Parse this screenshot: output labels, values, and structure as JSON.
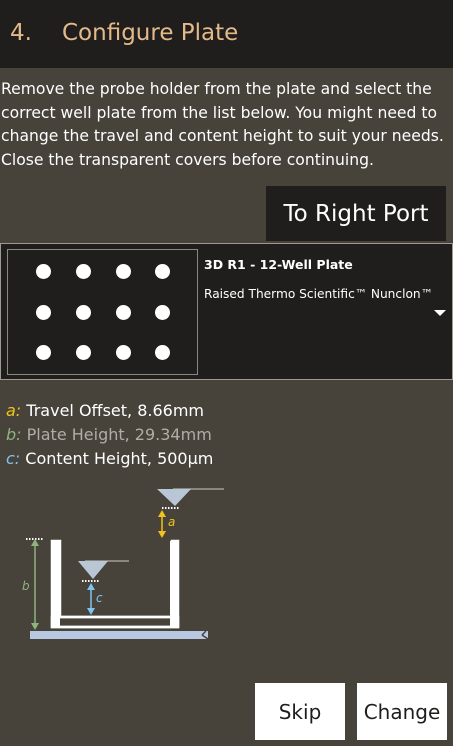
{
  "header": {
    "step_number": "4.",
    "title": "Configure Plate"
  },
  "instructions": "Remove the probe holder from the plate and select the correct well plate from the list below. You might need to change the travel and content height to suit your needs. Close the transparent covers before continuing.",
  "port_button": {
    "label": "To Right Port"
  },
  "plate_select": {
    "name": "3D R1 - 12-Well Plate",
    "description": "Raised Thermo Scientific™ Nunclon™ |",
    "wells": {
      "rows": 3,
      "columns": 4
    }
  },
  "parameters": [
    {
      "key": "a:",
      "text": "Travel Offset, 8.66mm",
      "key_color": "#f0c419",
      "text_color": "#ffffff"
    },
    {
      "key": "b:",
      "text": "Plate Height, 29.34mm",
      "key_color": "#8fb37f",
      "text_color": "#b0ada6"
    },
    {
      "key": "c:",
      "text": "Content Height, 500μm",
      "key_color": "#7fc4ee",
      "text_color": "#ffffff"
    }
  ],
  "diagram": {
    "label_a": "a",
    "label_b": "b",
    "label_c": "c"
  },
  "buttons": {
    "skip": "Skip",
    "change": "Change"
  },
  "colors": {
    "background": "#47433b",
    "header_bg": "#1f1e1d",
    "title_accent": "#e4b98a",
    "offset_yellow": "#f0c419",
    "height_green": "#8fb37f",
    "content_blue": "#7fc4ee"
  }
}
